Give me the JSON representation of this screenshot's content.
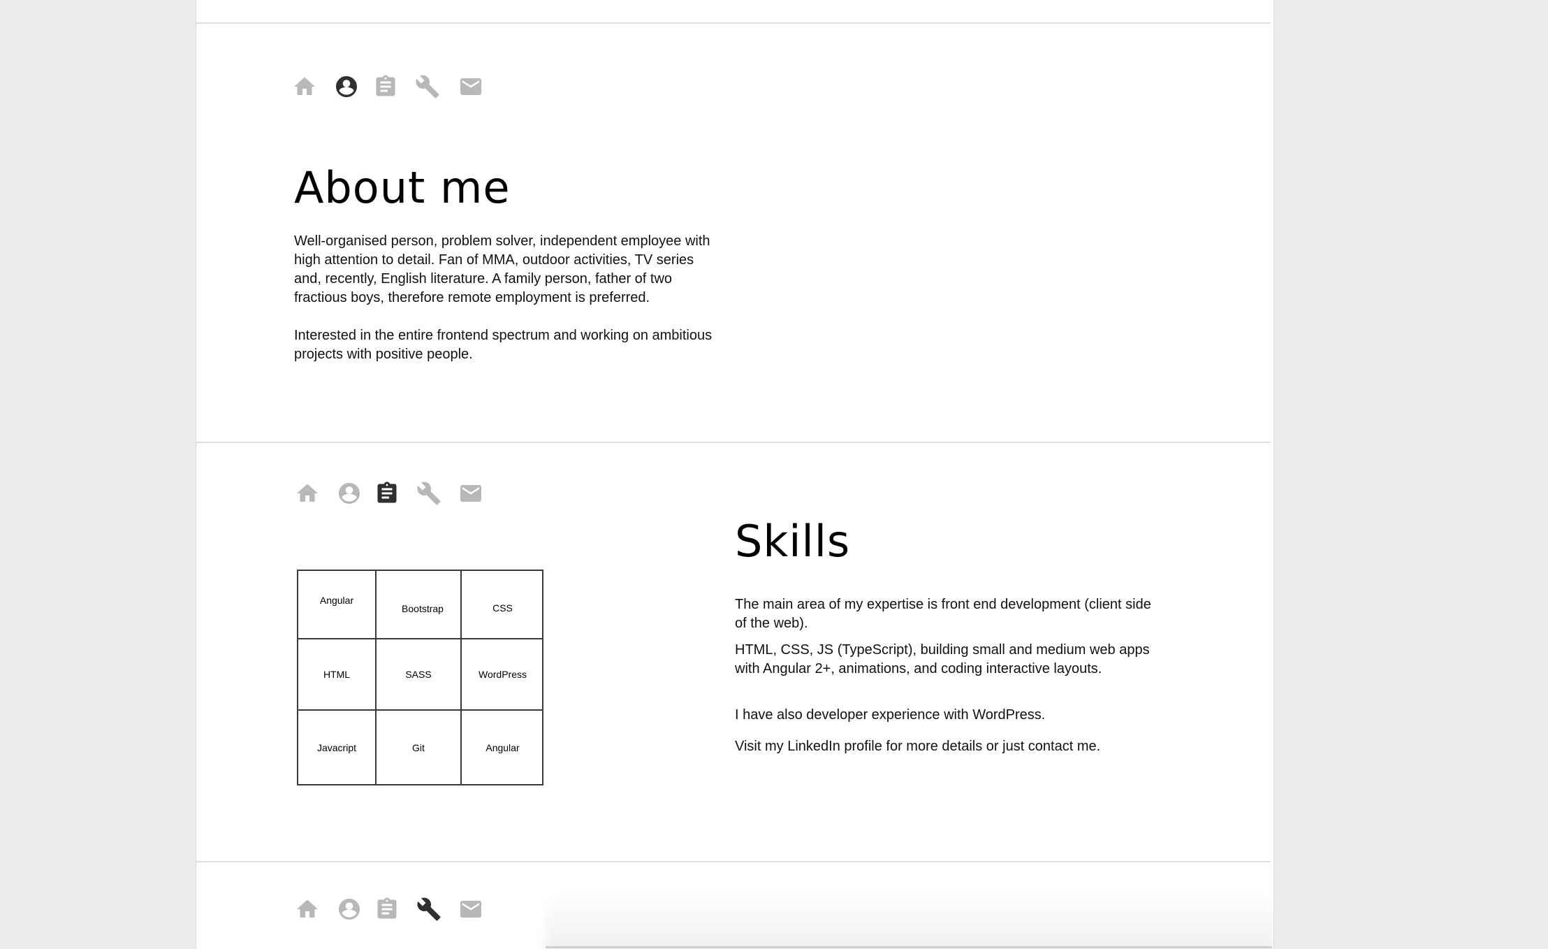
{
  "colors": {
    "icon_inactive": "#b8b8b8",
    "icon_active": "#2f2f2f",
    "rule": "#dedede",
    "background": "#ececec"
  },
  "nav_icons": [
    "home-icon",
    "account-circle-icon",
    "clipboard-icon",
    "wrench-icon",
    "mail-icon"
  ],
  "about": {
    "active_icon": "account-circle-icon",
    "title": "About me",
    "paragraph_1": "Well-organised person, problem solver, independent employee with high attention to detail. Fan of MMA, outdoor activities, TV series and, recently, English literature. A family person, father of two fractious boys, therefore remote employment is preferred.",
    "paragraph_2": "Interested in the entire frontend spectrum and working on ambitious projects with positive people."
  },
  "skills": {
    "active_icon": "clipboard-icon",
    "title": "Skills",
    "grid": [
      [
        "Angular",
        "Bootstrap",
        "CSS"
      ],
      [
        "HTML",
        "SASS",
        "WordPress"
      ],
      [
        "Javacript",
        "Git",
        "Angular"
      ]
    ],
    "paragraph_1": "The main area of my expertise is front end development (client side of the web).",
    "paragraph_2": "HTML, CSS, JS (TypeScript), building small and medium web apps with Angular 2+, animations, and coding interactive layouts.",
    "paragraph_3": "I have also  developer experience with WordPress.",
    "paragraph_4": "Visit my LinkedIn profile for more details or just contact me."
  },
  "projects": {
    "active_icon": "wrench-icon"
  }
}
